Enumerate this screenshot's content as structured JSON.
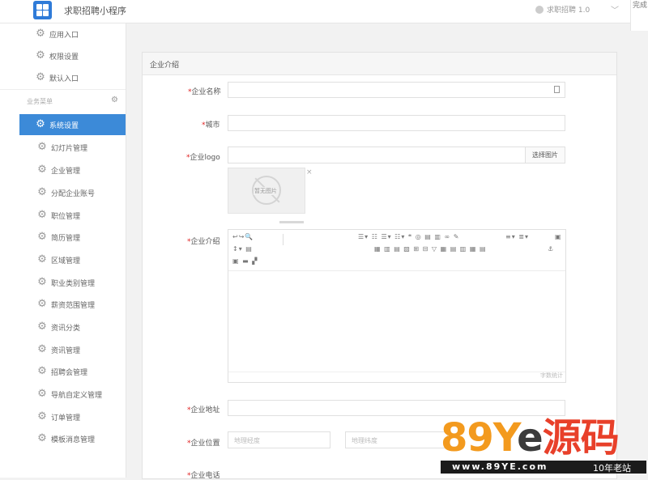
{
  "header": {
    "app_title": "求职招聘小程序",
    "account_label": "求职招聘 1.0",
    "finish_label": "完成"
  },
  "sidebar": {
    "top_items": [
      {
        "label": "应用入口",
        "icon": "gear-icon"
      },
      {
        "label": "权限设置",
        "icon": "gear-icon"
      },
      {
        "label": "默认入口",
        "icon": "gear-icon"
      }
    ],
    "section_label": "业务菜单",
    "items": [
      {
        "label": "系统设置",
        "active": true
      },
      {
        "label": "幻灯片管理"
      },
      {
        "label": "企业管理"
      },
      {
        "label": "分配企业账号"
      },
      {
        "label": "职位管理"
      },
      {
        "label": "简历管理"
      },
      {
        "label": "区域管理"
      },
      {
        "label": "职业类别管理"
      },
      {
        "label": "薪资范围管理"
      },
      {
        "label": "资讯分类"
      },
      {
        "label": "资讯管理"
      },
      {
        "label": "招聘会管理"
      },
      {
        "label": "导航自定义管理"
      },
      {
        "label": "订单管理"
      },
      {
        "label": "模板消息管理"
      }
    ],
    "accent_color": "#3c8ad8"
  },
  "form": {
    "panel_title": "企业介绍",
    "required_mark": "*",
    "fields": {
      "company_name": {
        "label": "企业名称",
        "value": ""
      },
      "city": {
        "label": "城市",
        "value": ""
      },
      "logo": {
        "label": "企业logo",
        "value": "",
        "button": "选择图片",
        "no_image_text": "暂无图片"
      },
      "intro": {
        "label": "企业介绍",
        "char_count_label": "字数统计"
      },
      "address": {
        "label": "企业地址",
        "value": ""
      },
      "location": {
        "label": "企业位置",
        "lng_placeholder": "地理经度",
        "lat_placeholder": "地理纬度"
      },
      "phone": {
        "label": "企业电话"
      }
    }
  },
  "watermark": {
    "logo_digits": "89Y",
    "logo_e": "e",
    "logo_cn": "源码",
    "site": "www.89YE.com",
    "tagline": "10年老站",
    "colors": {
      "digits": "#f39a1e",
      "e": "#3b3b3b",
      "cn": "#e8402a",
      "strip": "#1b1b1b"
    }
  }
}
